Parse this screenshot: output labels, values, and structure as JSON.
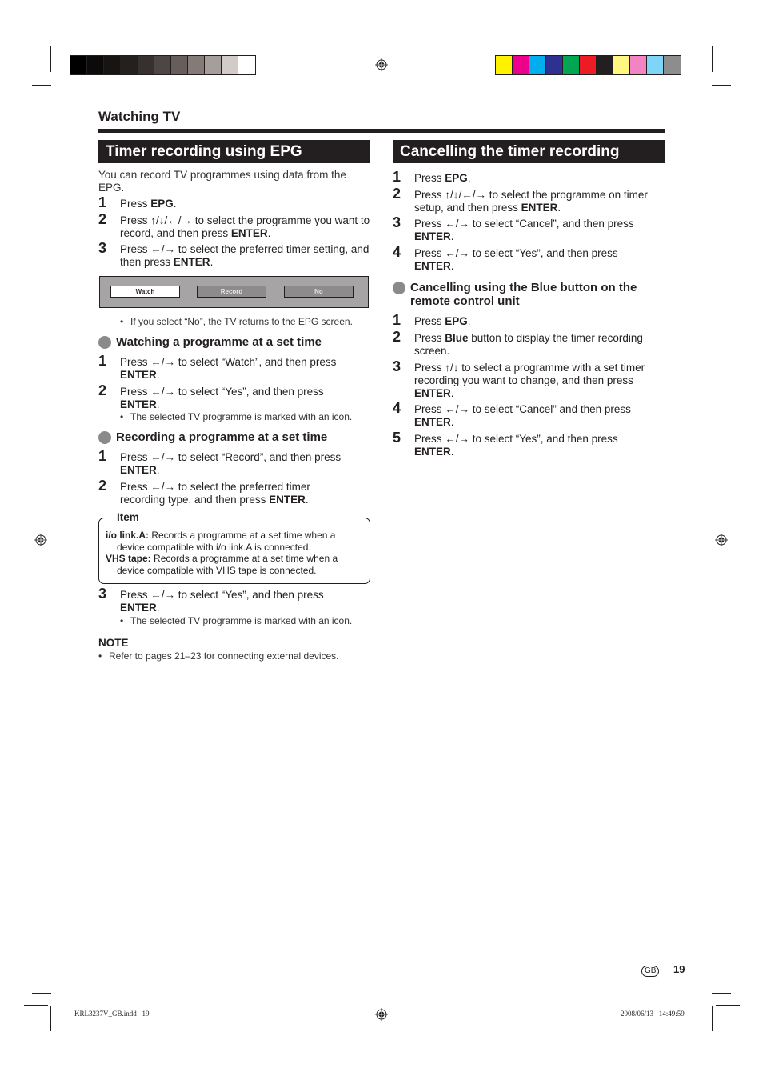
{
  "print_marks": {
    "grayscale_bar": [
      "#000000",
      "#0d0b0a",
      "#181413",
      "#24201e",
      "#36302e",
      "#4e4644",
      "#675e5b",
      "#847b77",
      "#a59e9b",
      "#d3cbc8",
      "#ffffff"
    ],
    "color_bar": [
      "#fff200",
      "#ec008c",
      "#00aeef",
      "#2e3192",
      "#00a651",
      "#ed1c24",
      "#231f20",
      "#fff77f",
      "#f384c4",
      "#7fd5f7",
      "#8d8d8d"
    ],
    "registration_icon": "registration-mark-icon"
  },
  "chapter": "Watching TV",
  "left": {
    "title": "Timer recording using EPG",
    "intro": "You can record TV programmes using data from the EPG.",
    "steps": [
      {
        "num": "1",
        "pre": "Press ",
        "bold": "EPG",
        "post": "."
      },
      {
        "num": "2",
        "pre": "Press ↑/↓/←/→ to select the programme you want to record, and then press ",
        "bold": "ENTER",
        "post": "."
      },
      {
        "num": "3",
        "pre": "Press ←/→ to select the preferred timer setting, and then press ",
        "bold": "ENTER",
        "post": "."
      }
    ],
    "osd": {
      "buttons": [
        {
          "label": "Watch",
          "selected": true
        },
        {
          "label": "Record",
          "selected": false
        },
        {
          "label": "No",
          "selected": false
        }
      ]
    },
    "osd_note": "If you select “No”, the TV returns to the EPG screen.",
    "watching": {
      "title": "Watching a programme at a set time",
      "steps": [
        {
          "num": "1",
          "pre": "Press ←/→ to select “Watch”, and then press ",
          "bold": "ENTER",
          "post": "."
        },
        {
          "num": "2",
          "pre": "Press ←/→ to select “Yes”, and then press ",
          "bold": "ENTER",
          "post": "."
        }
      ],
      "note": "The selected TV programme is marked with an icon."
    },
    "recording": {
      "title": "Recording a programme at a set time",
      "steps": [
        {
          "num": "1",
          "pre": "Press ←/→ to select “Record”, and then press ",
          "bold": "ENTER",
          "post": "."
        },
        {
          "num": "2",
          "pre": "Press ←/→ to select the preferred timer recording type, and then press ",
          "bold": "ENTER",
          "post": "."
        },
        {
          "num": "3",
          "pre": "Press ←/→ to select “Yes”, and then press ",
          "bold": "ENTER",
          "post": "."
        }
      ],
      "item_box": {
        "title": "Item",
        "rows": [
          {
            "term": "i/o link.A:",
            "first": " Records a programme at a set time when a",
            "rest": "device compatible with i/o link.A is connected."
          },
          {
            "term": "VHS tape:",
            "first": " Records a programme at a set time when a",
            "rest": "device compatible with VHS tape is connected."
          }
        ]
      },
      "note": "The selected TV programme is marked with an icon."
    },
    "note_heading": "NOTE",
    "note": "Refer to pages 21–23 for connecting external devices."
  },
  "right": {
    "title": "Cancelling the timer recording",
    "steps": [
      {
        "num": "1",
        "pre": "Press ",
        "bold": "EPG",
        "post": "."
      },
      {
        "num": "2",
        "pre": "Press ↑/↓/←/→ to select the programme on timer setup, and then press ",
        "bold": "ENTER",
        "post": "."
      },
      {
        "num": "3",
        "pre": "Press ←/→ to select “Cancel”, and then press ",
        "bold": "ENTER",
        "post": "."
      },
      {
        "num": "4",
        "pre": "Press ←/→ to select “Yes”, and then press ",
        "bold": "ENTER",
        "post": "."
      }
    ],
    "blue": {
      "title": "Cancelling using the Blue button on the remote control unit",
      "steps": [
        {
          "num": "1",
          "pre": "Press ",
          "bold": "EPG",
          "post": "."
        },
        {
          "num": "2",
          "pre": "Press ",
          "bold": "Blue",
          "post": " button to display the timer recording screen."
        },
        {
          "num": "3",
          "pre": "Press ↑/↓ to select a programme with a set timer recording you want to change, and then press ",
          "bold": "ENTER",
          "post": "."
        },
        {
          "num": "4",
          "pre": "Press ←/→ to select “Cancel” and then press ",
          "bold": "ENTER",
          "post": "."
        },
        {
          "num": "5",
          "pre": "Press ←/→ to select “Yes”, and then press ",
          "bold": "ENTER",
          "post": "."
        }
      ]
    }
  },
  "footer": {
    "region_badge": "GB",
    "separator": "-",
    "page_number": "19",
    "slug_file": "KRL3237V_GB.indd   19",
    "slug_date": "2008/06/13   14:49:59"
  }
}
